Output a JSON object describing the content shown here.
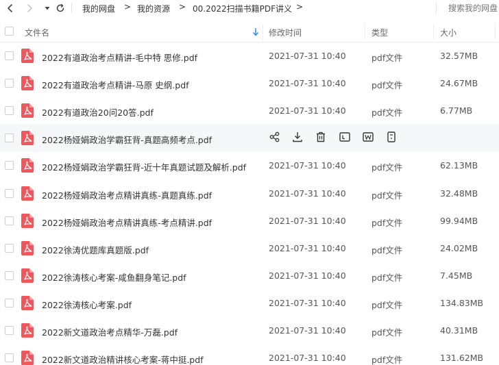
{
  "breadcrumb": {
    "items": [
      "我的网盘",
      "我的资源",
      "00.2022扫描书籍PDF讲义"
    ],
    "separator": ">"
  },
  "search": {
    "placeholder": "搜索我的网盘"
  },
  "table": {
    "headers": {
      "name": "文件名",
      "modified": "修改时间",
      "type": "类型",
      "size": "大小"
    },
    "rows": [
      {
        "name": "2022有道政治考点精讲-毛中特 思修.pdf",
        "time": "2021-07-31 10:40",
        "type": "pdf文件",
        "size": "32.57MB"
      },
      {
        "name": "2022有道政治考点精讲-马原 史纲.pdf",
        "time": "2021-07-31 10:40",
        "type": "pdf文件",
        "size": "24.67MB"
      },
      {
        "name": "2022有道政治20问20答.pdf",
        "time": "2021-07-31 10:40",
        "type": "pdf文件",
        "size": "6.77MB"
      },
      {
        "name": "2022杨娅娟政治学霸狂背-真题高频考点.pdf",
        "time": "",
        "type": "",
        "size": "",
        "hover": true
      },
      {
        "name": "2022杨娅娟政治学霸狂背-近十年真题试题及解析.pdf",
        "time": "2021-07-31 10:40",
        "type": "pdf文件",
        "size": "62.13MB"
      },
      {
        "name": "2022杨娅娟政治考点精讲真练-真题真练.pdf",
        "time": "2021-07-31 10:40",
        "type": "pdf文件",
        "size": "32.48MB"
      },
      {
        "name": "2022杨娅娟政治考点精讲真练-考点精讲.pdf",
        "time": "2021-07-31 10:40",
        "type": "pdf文件",
        "size": "99.94MB"
      },
      {
        "name": "2022徐涛优题库真题版.pdf",
        "time": "2021-07-31 10:40",
        "type": "pdf文件",
        "size": "24.02MB"
      },
      {
        "name": "2022徐涛核心考案-咸鱼翻身笔记.pdf",
        "time": "2021-07-31 10:40",
        "type": "pdf文件",
        "size": "7.45MB"
      },
      {
        "name": "2022徐涛核心考案.pdf",
        "time": "2021-07-31 10:40",
        "type": "pdf文件",
        "size": "134.83MB"
      },
      {
        "name": "2022新文道政治考点精华-万磊.pdf",
        "time": "2021-07-31 10:40",
        "type": "pdf文件",
        "size": "40.31MB"
      },
      {
        "name": "2022新文道政治精讲核心考案-蒋中挺.pdf",
        "time": "2021-07-31 10:40",
        "type": "pdf文件",
        "size": "131.62MB"
      }
    ]
  },
  "hover_actions": [
    "share-icon",
    "download-icon",
    "delete-icon",
    "rename-icon",
    "copy-icon",
    "more-icon"
  ],
  "colors": {
    "pdf_icon": "#f0575d",
    "sort_arrow": "#2f8bf5",
    "hover_row": "#f6f7f9"
  }
}
